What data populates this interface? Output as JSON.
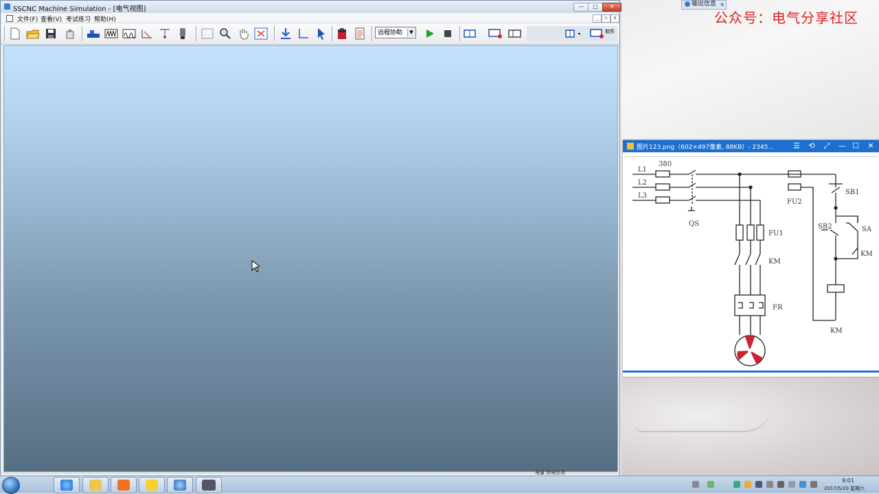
{
  "app": {
    "title": "SSCNC Machine Simulation - [电气视图]",
    "window_buttons": {
      "minimize": "—",
      "maximize": "□",
      "close": "✕"
    },
    "mdi_buttons": {
      "minimize": "_",
      "restore": "▫",
      "close": "x"
    },
    "menu": [
      "文件(F)",
      "查看(V)",
      "考试练习",
      "帮助(H)"
    ],
    "remote_combo": "远程协助",
    "toolbar_right_label": "软件"
  },
  "toolbar_icons": [
    "new-file-icon",
    "open-folder-icon",
    "save-icon",
    "export-icon",
    "machine-icon",
    "waveform-icon",
    "waveform-alt-icon",
    "measure-icon",
    "probe-icon",
    "gauge-icon",
    "select-rect-icon",
    "zoom-icon",
    "pan-hand-icon",
    "fit-view-icon",
    "download-icon",
    "axis-icon",
    "pointer-icon",
    "battery-icon",
    "notes-icon",
    "play-icon",
    "stop-icon",
    "layout-split-icon",
    "layout-record-icon",
    "layout-single-icon"
  ],
  "overlay": {
    "watermark": "公众号：电气分享社区",
    "output_tab": "输出信息"
  },
  "viewer": {
    "title": "图片123.png（602×497像素, 88KB）- 2345...",
    "buttons": [
      "☰",
      "⟲",
      "⤢",
      "—",
      "☐",
      "✕"
    ],
    "diagram": {
      "labels": {
        "l1": "L1",
        "l2": "L2",
        "l3": "L3",
        "voltage": "380",
        "qs": "QS",
        "fu1": "FU1",
        "fu2": "FU2",
        "km_main": "KM",
        "fr": "FR",
        "sb1": "SB1",
        "sb2": "SB2",
        "sa": "SA",
        "km_aux": "KM",
        "km_coil": "KM"
      }
    }
  },
  "statusbar": {
    "text": "电量 用电负荷"
  },
  "taskbar": {
    "apps": [
      "browser",
      "file-explorer",
      "presentation",
      "notepad",
      "sscnc",
      "simulator"
    ],
    "time": "9:01",
    "date": "2017/5/20 星期六"
  },
  "colors": {
    "titlebar_blue": "#1e6fd0",
    "watermark_red": "#e0201f",
    "fan_red": "#c82332"
  }
}
